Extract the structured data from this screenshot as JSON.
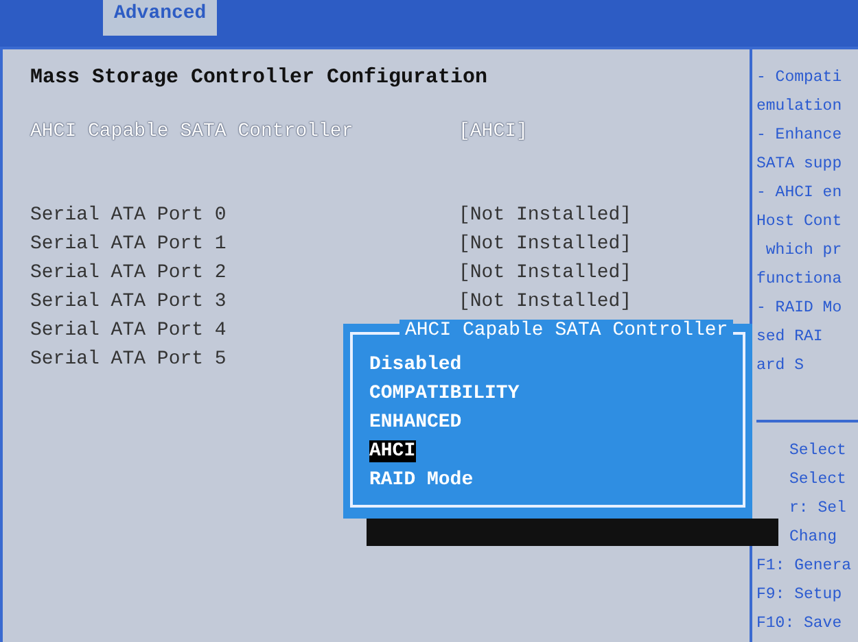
{
  "tabs": [
    {
      "label": "Advanced",
      "selected": true
    }
  ],
  "section_title": "Mass Storage Controller Configuration",
  "settings": [
    {
      "label": "AHCI Capable SATA Controller",
      "value": "[AHCI]",
      "selected": true
    }
  ],
  "ports": [
    {
      "label": "Serial ATA Port 0",
      "value": "[Not Installed]",
      "selected": false
    },
    {
      "label": "Serial ATA Port 1",
      "value": "[Not Installed]",
      "selected": false
    },
    {
      "label": "Serial ATA Port 2",
      "value": "[Not Installed]",
      "selected": false
    },
    {
      "label": "Serial ATA Port 3",
      "value": "[Not Installed]",
      "selected": false
    },
    {
      "label": "Serial ATA Port 4",
      "selected": false
    },
    {
      "label": "Serial ATA Port 5",
      "selected": false
    }
  ],
  "help_text": [
    "- Compati",
    "emulation",
    "- Enhance",
    "SATA supp",
    "- AHCI en",
    "Host Cont",
    " which pr",
    "functiona",
    "- RAID Mo",
    "sed RAI",
    "ard S"
  ],
  "key_help": [
    "Select",
    "Select",
    "r: Sel",
    "Chang",
    "F1: Genera",
    "F9: Setup",
    "F10: Save"
  ],
  "popup": {
    "title": "AHCI Capable SATA Controller",
    "options": [
      {
        "label": "Disabled",
        "selected": false
      },
      {
        "label": "COMPATIBILITY",
        "selected": false
      },
      {
        "label": "ENHANCED",
        "selected": false
      },
      {
        "label": "AHCI",
        "selected": true
      },
      {
        "label": "RAID Mode",
        "selected": false
      }
    ]
  }
}
